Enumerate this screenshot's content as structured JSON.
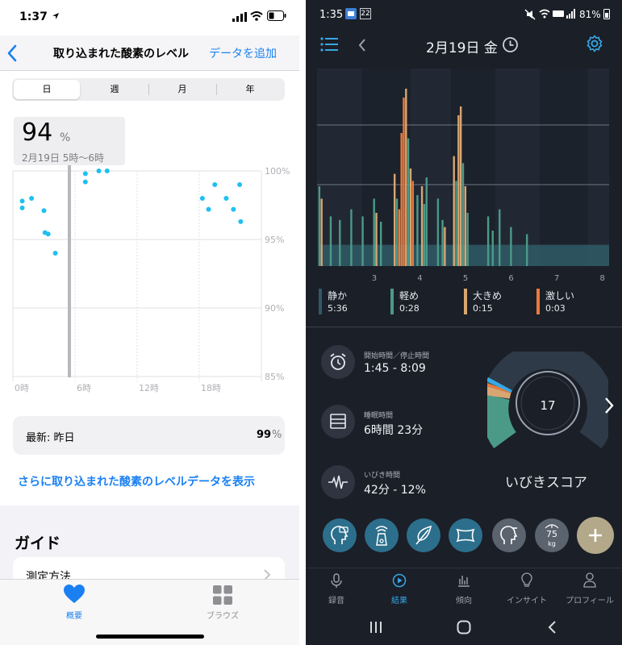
{
  "left": {
    "status_time": "1:37",
    "nav": {
      "title": "取り込まれた酸素のレベル",
      "add": "データを追加"
    },
    "segments": [
      "日",
      "週",
      "月",
      "年"
    ],
    "tooltip": {
      "value": "94",
      "unit": "%",
      "range": "2月19日 5時〜6時"
    },
    "chart": {
      "y_labels": [
        "100%",
        "95%",
        "90%",
        "85%"
      ],
      "x_labels": [
        "0時",
        "6時",
        "12時",
        "18時"
      ]
    },
    "latest": {
      "label": "最新: 昨日",
      "value": "99",
      "unit": "%"
    },
    "show_more": "さらに取り込まれた酸素のレベルデータを表示",
    "guide_title": "ガイド",
    "guide_item": "測定方法",
    "tabs": [
      {
        "label": "概要"
      },
      {
        "label": "ブラウズ"
      }
    ],
    "colors": {
      "accent": "#1a80f2",
      "dot": "#1ec0f0"
    }
  },
  "right": {
    "status_time": "1:35",
    "status_badge": "22",
    "battery": "81%",
    "header_date": "2月19日 金",
    "x_ticks": [
      "3",
      "4",
      "5",
      "6",
      "7",
      "8"
    ],
    "legend": [
      {
        "label": "静か",
        "value": "5:36",
        "color": "#2f5a67"
      },
      {
        "label": "軽め",
        "value": "0:28",
        "color": "#4b9a88"
      },
      {
        "label": "大きめ",
        "value": "0:15",
        "color": "#d8a672"
      },
      {
        "label": "激しい",
        "value": "0:03",
        "color": "#e87a3c"
      }
    ],
    "info": [
      {
        "label": "開始時間／停止時間",
        "value": "1:45 - 8:09"
      },
      {
        "label": "睡眠時間",
        "value": "6時間 23分"
      },
      {
        "label": "いびき時間",
        "value": "42分 - 12%"
      }
    ],
    "score": {
      "value": "17",
      "label": "いびきスコア"
    },
    "weight": {
      "value": "75",
      "unit": "kg"
    },
    "tabs": [
      {
        "label": "録音"
      },
      {
        "label": "結果"
      },
      {
        "label": "傾向"
      },
      {
        "label": "インサイト"
      },
      {
        "label": "プロフィール"
      }
    ]
  },
  "chart_data": [
    {
      "type": "scatter",
      "title": "",
      "xlabel": "",
      "ylabel": "",
      "x_ticks": [
        "0時",
        "6時",
        "12時",
        "18時"
      ],
      "y_ticks": [
        "100%",
        "95%",
        "90%",
        "85%"
      ],
      "ylim": [
        85,
        100
      ],
      "xlim": [
        0,
        24
      ],
      "series": [
        {
          "points": [
            [
              0.9,
              97.8
            ],
            [
              0.9,
              97.3
            ],
            [
              1.8,
              98.0
            ],
            [
              3.0,
              97.1
            ],
            [
              3.1,
              95.5
            ],
            [
              3.4,
              95.4
            ],
            [
              4.1,
              94.0
            ],
            [
              7.0,
              99.8
            ],
            [
              7.0,
              99.2
            ],
            [
              8.3,
              100.0
            ],
            [
              9.1,
              100.0
            ],
            [
              18.3,
              98.0
            ],
            [
              18.9,
              97.2
            ],
            [
              19.5,
              99.0
            ],
            [
              20.6,
              98.0
            ],
            [
              21.3,
              97.2
            ],
            [
              21.9,
              99.0
            ],
            [
              22.0,
              96.3
            ]
          ]
        }
      ]
    },
    {
      "type": "bar",
      "title": "",
      "xlabel": "",
      "ylabel": "",
      "x_ticks": [
        "3",
        "4",
        "5",
        "6",
        "7",
        "8"
      ],
      "xlim": [
        1.75,
        8.15
      ],
      "ylim": [
        0,
        1
      ],
      "baseline_level": 0.12,
      "series": [
        {
          "name": "静か",
          "color": "#2f5a67"
        },
        {
          "name": "軽め",
          "color": "#4b9a88"
        },
        {
          "name": "大きめ",
          "color": "#d8a672"
        },
        {
          "name": "激しい",
          "color": "#e87a3c"
        }
      ],
      "bars": [
        [
          1.8,
          0.45,
          1
        ],
        [
          1.85,
          0.38,
          2
        ],
        [
          2.05,
          0.28,
          1
        ],
        [
          2.25,
          0.26,
          1
        ],
        [
          2.5,
          0.32,
          1
        ],
        [
          2.75,
          0.28,
          1
        ],
        [
          3.0,
          0.38,
          1
        ],
        [
          3.05,
          0.3,
          2
        ],
        [
          3.15,
          0.25,
          1
        ],
        [
          3.45,
          0.52,
          2
        ],
        [
          3.5,
          0.38,
          1
        ],
        [
          3.55,
          0.32,
          3
        ],
        [
          3.6,
          0.75,
          3
        ],
        [
          3.65,
          0.95,
          3
        ],
        [
          3.7,
          1.0,
          2
        ],
        [
          3.75,
          0.72,
          1
        ],
        [
          3.8,
          0.55,
          2
        ],
        [
          3.85,
          0.48,
          3
        ],
        [
          3.95,
          0.4,
          1
        ],
        [
          4.05,
          0.45,
          2
        ],
        [
          4.1,
          0.35,
          1
        ],
        [
          4.15,
          0.5,
          1
        ],
        [
          4.4,
          0.38,
          1
        ],
        [
          4.5,
          0.26,
          1
        ],
        [
          4.55,
          0.22,
          2
        ],
        [
          4.75,
          0.62,
          2
        ],
        [
          4.8,
          0.48,
          1
        ],
        [
          4.85,
          0.85,
          2
        ],
        [
          4.9,
          0.9,
          2
        ],
        [
          4.95,
          0.58,
          1
        ],
        [
          5.0,
          0.45,
          2
        ],
        [
          5.05,
          0.3,
          1
        ],
        [
          5.5,
          0.28,
          1
        ],
        [
          5.6,
          0.2,
          1
        ],
        [
          5.75,
          0.32,
          1
        ],
        [
          6.0,
          0.22,
          1
        ],
        [
          6.35,
          0.18,
          1
        ]
      ]
    }
  ]
}
